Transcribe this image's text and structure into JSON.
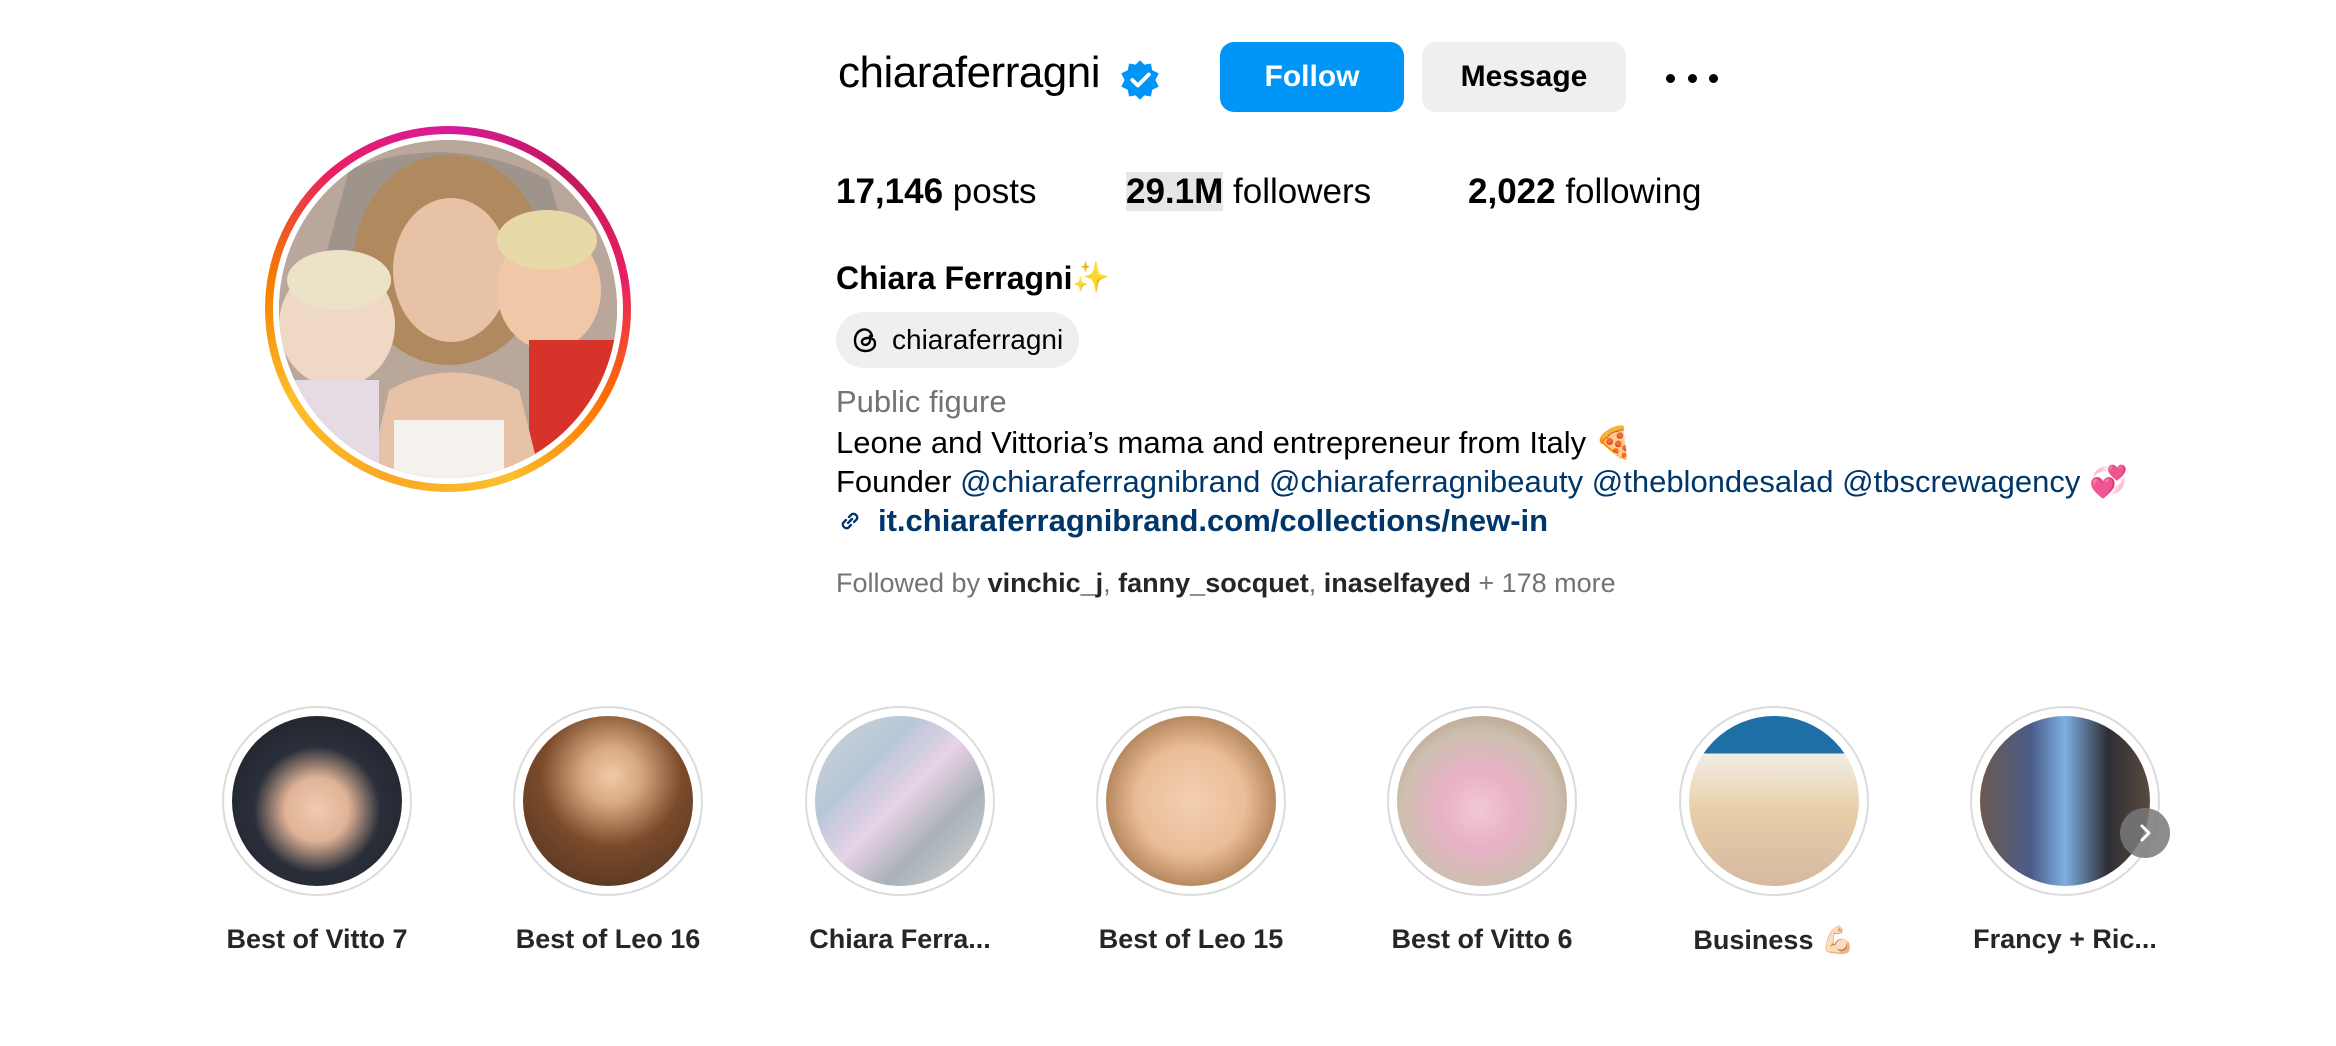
{
  "profile": {
    "username": "chiaraferragni",
    "verified_icon": "verified-badge-icon",
    "follow_label": "Follow",
    "message_label": "Message",
    "more_icon": "more-options-icon"
  },
  "stats": {
    "posts_count": "17,146",
    "posts_label": "posts",
    "followers_count": "29.1M",
    "followers_label": "followers",
    "following_count": "2,022",
    "following_label": "following"
  },
  "bio": {
    "full_name": "Chiara Ferragni",
    "name_emoji": "✨",
    "threads_handle": "chiaraferragni",
    "category": "Public figure",
    "line1": "Leone and Vittoria’s mama and entrepreneur from Italy",
    "line1_emoji": "🍕",
    "line2_prefix": "Founder",
    "mentions": [
      "@chiaraferragnibrand",
      "@chiaraferragnibeauty",
      "@theblondesalad",
      "@tbscrewagency"
    ],
    "line2_emoji": "💞",
    "link": "it.chiaraferragnibrand.com/collections/new-in",
    "followed_by_prefix": "Followed by",
    "followed_by_users": [
      "vinchic_j",
      "fanny_socquet",
      "inaselfayed"
    ],
    "followed_by_more": "+ 178 more"
  },
  "highlights": [
    {
      "label": "Best of Vitto 7"
    },
    {
      "label": "Best of Leo 16"
    },
    {
      "label": "Chiara Ferra..."
    },
    {
      "label": "Best of Leo 15"
    },
    {
      "label": "Best of Vitto 6"
    },
    {
      "label": "Business 💪🏻"
    },
    {
      "label": "Francy + Ric..."
    }
  ],
  "colors": {
    "follow_button": "#0095f6",
    "secondary_button": "#efefef",
    "link": "#00376b",
    "muted_text": "#737373"
  }
}
